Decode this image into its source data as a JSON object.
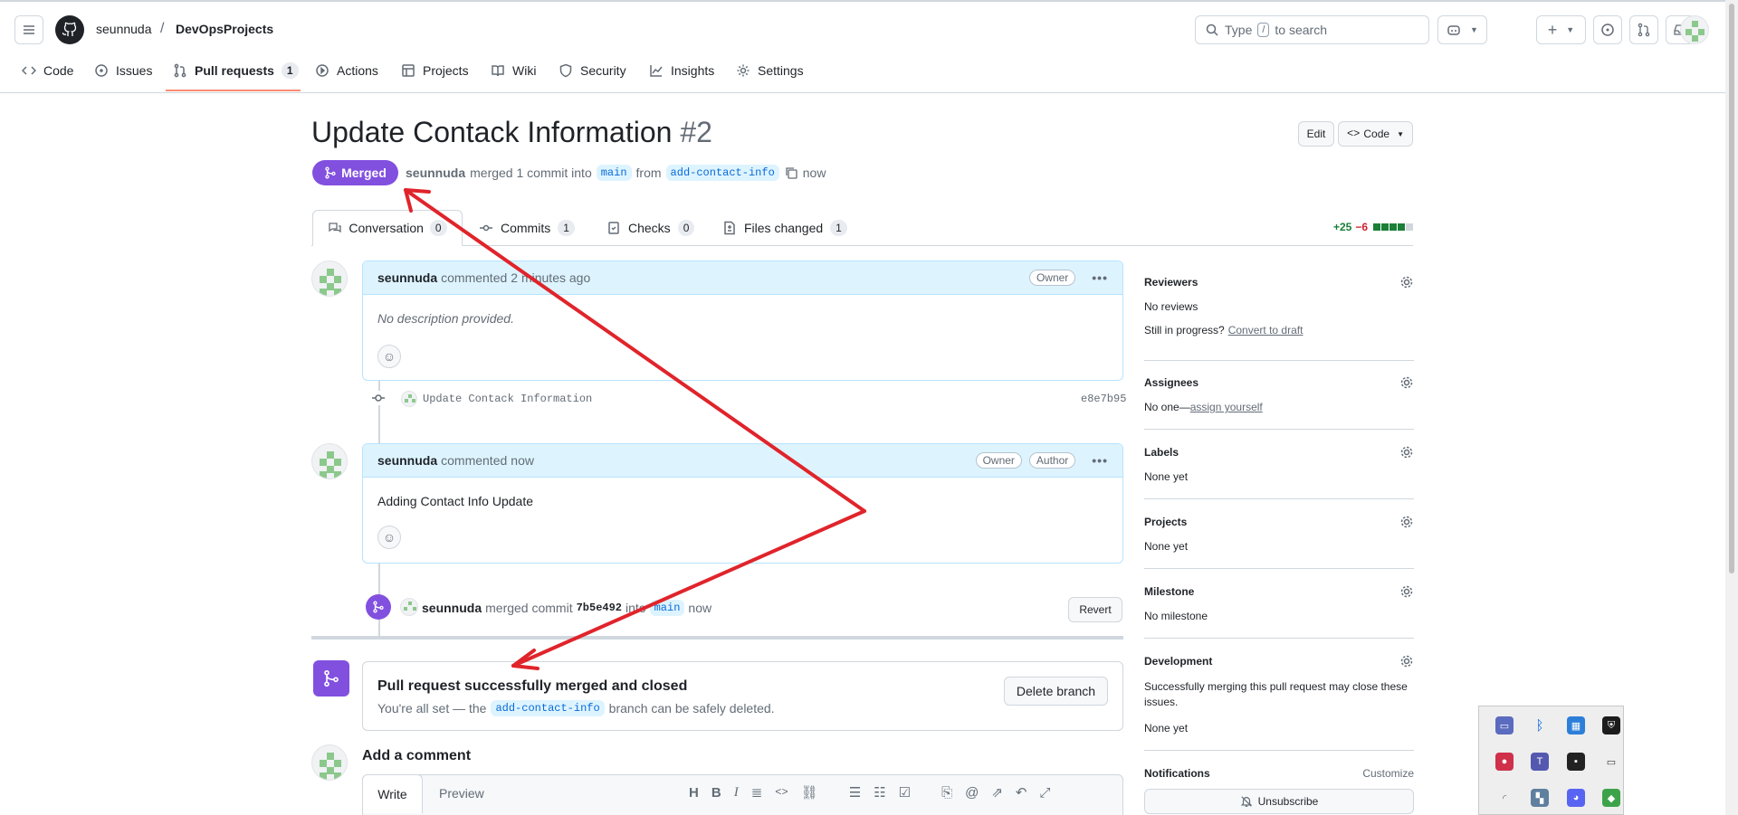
{
  "header": {
    "owner": "seunnuda",
    "separator": "/",
    "repo": "DevOpsProjects",
    "search_prefix": "Type",
    "search_key": "/",
    "search_suffix": "to search"
  },
  "repo_nav": {
    "items": [
      {
        "label": "Code",
        "icon": "code-icon"
      },
      {
        "label": "Issues",
        "icon": "issue-icon"
      },
      {
        "label": "Pull requests",
        "icon": "pull-request-icon",
        "count": "1"
      },
      {
        "label": "Actions",
        "icon": "play-icon"
      },
      {
        "label": "Projects",
        "icon": "table-icon"
      },
      {
        "label": "Wiki",
        "icon": "book-icon"
      },
      {
        "label": "Security",
        "icon": "shield-icon"
      },
      {
        "label": "Insights",
        "icon": "graph-icon"
      },
      {
        "label": "Settings",
        "icon": "gear-icon"
      }
    ]
  },
  "pr": {
    "title": "Update Contack Information",
    "number": "#2",
    "state": "Merged",
    "author": "seunnuda",
    "merged_text": "merged 1 commit into",
    "base_branch": "main",
    "from_text": "from",
    "head_branch": "add-contact-info",
    "time": "now",
    "edit_label": "Edit",
    "code_label": "Code"
  },
  "tabs": [
    {
      "label": "Conversation",
      "count": "0"
    },
    {
      "label": "Commits",
      "count": "1"
    },
    {
      "label": "Checks",
      "count": "0"
    },
    {
      "label": "Files changed",
      "count": "1"
    }
  ],
  "diffstat": {
    "additions": "+25",
    "deletions": "−6"
  },
  "timeline": {
    "comment1": {
      "author": "seunnuda",
      "action": "commented",
      "time": "2 minutes ago",
      "role": "Owner",
      "body": "No description provided."
    },
    "commit": {
      "message": "Update Contack Information",
      "sha": "e8e7b95"
    },
    "comment2": {
      "author": "seunnuda",
      "action": "commented",
      "time": "now",
      "role1": "Owner",
      "role2": "Author",
      "body": "Adding Contact Info Update"
    },
    "merge_event": {
      "author": "seunnuda",
      "text": "merged commit",
      "sha": "7b5e492",
      "into": "into",
      "branch": "main",
      "time": "now",
      "revert_label": "Revert"
    },
    "merged_box": {
      "title": "Pull request successfully merged and closed",
      "text1": "You're all set — the",
      "branch": "add-contact-info",
      "text2": "branch can be safely deleted.",
      "delete_label": "Delete branch"
    },
    "add_comment": {
      "title": "Add a comment",
      "write_tab": "Write",
      "preview_tab": "Preview"
    }
  },
  "sidebar": {
    "reviewers": {
      "title": "Reviewers",
      "value": "No reviews",
      "in_progress": "Still in progress?",
      "link": "Convert to draft"
    },
    "assignees": {
      "title": "Assignees",
      "value": "No one—",
      "link": "assign yourself"
    },
    "labels": {
      "title": "Labels",
      "value": "None yet"
    },
    "projects": {
      "title": "Projects",
      "value": "None yet"
    },
    "milestone": {
      "title": "Milestone",
      "value": "No milestone"
    },
    "development": {
      "title": "Development",
      "text": "Successfully merging this pull request may close these issues.",
      "value": "None yet"
    },
    "notifications": {
      "title": "Notifications",
      "customize": "Customize",
      "button": "Unsubscribe"
    }
  },
  "colors": {
    "merged_purple": "#8250df",
    "annotation_red": "#e0242b",
    "add_green": "#1a7f37",
    "del_red": "#cf222e",
    "tab_underline": "#fd8c73"
  }
}
